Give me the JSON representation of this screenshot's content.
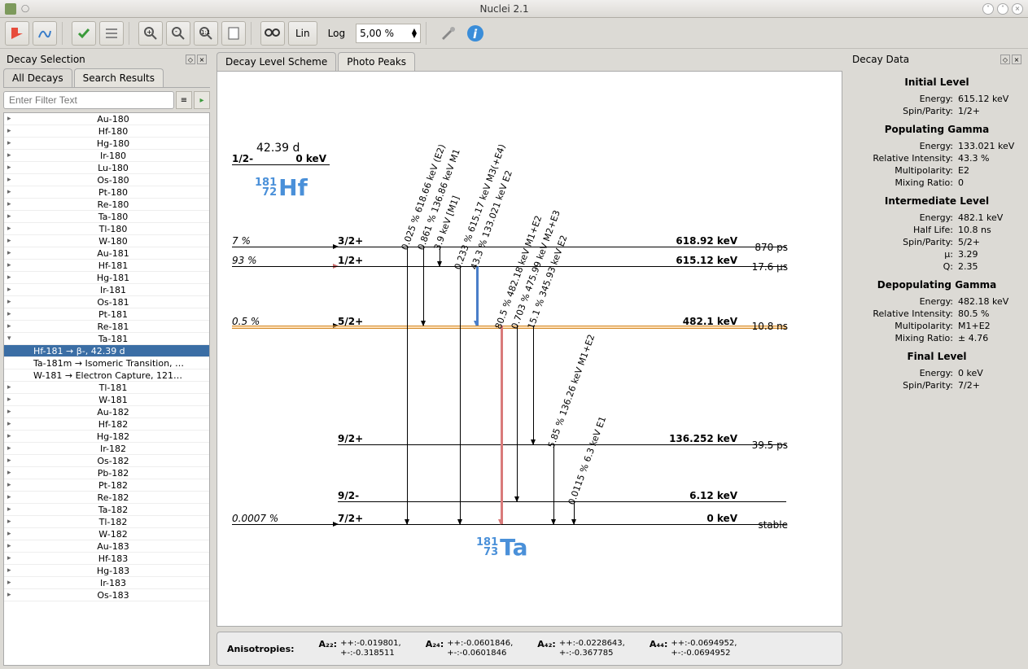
{
  "app": {
    "title": "Nuclei 2.1"
  },
  "toolbar": {
    "lin": "Lin",
    "log": "Log",
    "spinner": "5,00 %"
  },
  "left": {
    "title": "Decay Selection",
    "tab_all": "All Decays",
    "tab_search": "Search Results",
    "filter_placeholder": "Enter Filter Text",
    "items": [
      "Au-180",
      "Hf-180",
      "Hg-180",
      "Ir-180",
      "Lu-180",
      "Os-180",
      "Pt-180",
      "Re-180",
      "Ta-180",
      "Tl-180",
      "W-180",
      "Au-181",
      "Hf-181",
      "Hg-181",
      "Ir-181",
      "Os-181",
      "Pt-181",
      "Re-181",
      "Ta-181",
      "Tl-181",
      "W-181",
      "Au-182",
      "Hf-182",
      "Hg-182",
      "Ir-182",
      "Os-182",
      "Pb-182",
      "Pt-182",
      "Re-182",
      "Ta-182",
      "Tl-182",
      "W-182",
      "Au-183",
      "Hf-183",
      "Hg-183",
      "Ir-183",
      "Os-183"
    ],
    "ta181_children": [
      "Hf-181 → β-, 42.39 d",
      "Ta-181m → Isomeric Transition, …",
      "W-181 → Electron Capture, 121…"
    ]
  },
  "center": {
    "tab_scheme": "Decay Level Scheme",
    "tab_photo": "Photo Peaks",
    "parent_halflife": "42.39 d",
    "parent_spin": "1/2-",
    "parent_energy": "0 keV",
    "parent_nuclide": {
      "A": "181",
      "Z": "72",
      "sym": "Hf"
    },
    "daughter_nuclide": {
      "A": "181",
      "Z": "73",
      "sym": "Ta"
    },
    "levels": [
      {
        "spin": "3/2+",
        "energy": "618.92 keV",
        "hl": "870 ps",
        "pop": "7 %"
      },
      {
        "spin": "1/2+",
        "energy": "615.12 keV",
        "hl": "17.6 µs",
        "pop": "93 %"
      },
      {
        "spin": "5/2+",
        "energy": "482.1 keV",
        "hl": "10.8 ns",
        "pop": "0.5 %"
      },
      {
        "spin": "9/2+",
        "energy": "136.252 keV",
        "hl": "39.5 ps",
        "pop": ""
      },
      {
        "spin": "9/2-",
        "energy": "6.12 keV",
        "hl": "",
        "pop": ""
      },
      {
        "spin": "7/2+",
        "energy": "0 keV",
        "hl": "stable",
        "pop": "0.0007 %"
      }
    ],
    "gammas": [
      "0.025 % 618.66 keV (E2)",
      "0.861 % 136.86 keV M1",
      "3.9 keV [M1]",
      "0.233 % 615.17 keV M3(+E4)",
      "43.3 % 133.021 keV E2",
      "80.5 % 482.18 keV M1+E2",
      "0.703 % 475.99 keV M2+E3",
      "15.1 % 345.93 keV E2",
      "5.85 % 136.26 keV M1+E2",
      "0.0115 % 6.3 keV E1"
    ],
    "aniso": {
      "label": "Anisotropies:",
      "a22": {
        "k": "A₂₂:",
        "v": "++:-0.019801,\n+-:-0.318511"
      },
      "a24": {
        "k": "A₂₄:",
        "v": "++:-0.0601846,\n+-:-0.0601846"
      },
      "a42": {
        "k": "A₄₂:",
        "v": "++:-0.0228643,\n+-:-0.367785"
      },
      "a44": {
        "k": "A₄₄:",
        "v": "++:-0.0694952,\n+-:-0.0694952"
      }
    }
  },
  "right": {
    "title": "Decay Data",
    "sections": {
      "initial": {
        "h": "Initial Level",
        "rows": [
          [
            "Energy:",
            "615.12 keV"
          ],
          [
            "Spin/Parity:",
            "1/2+"
          ]
        ]
      },
      "popg": {
        "h": "Populating Gamma",
        "rows": [
          [
            "Energy:",
            "133.021 keV"
          ],
          [
            "Relative Intensity:",
            "43.3 %"
          ],
          [
            "Multipolarity:",
            "E2"
          ],
          [
            "Mixing Ratio:",
            "0"
          ]
        ]
      },
      "inter": {
        "h": "Intermediate Level",
        "rows": [
          [
            "Energy:",
            "482.1 keV"
          ],
          [
            "Half Life:",
            "10.8 ns"
          ],
          [
            "Spin/Parity:",
            "5/2+"
          ],
          [
            "µ:",
            "3.29"
          ],
          [
            "Q:",
            "2.35"
          ]
        ]
      },
      "depg": {
        "h": "Depopulating Gamma",
        "rows": [
          [
            "Energy:",
            "482.18 keV"
          ],
          [
            "Relative Intensity:",
            "80.5 %"
          ],
          [
            "Multipolarity:",
            "M1+E2"
          ],
          [
            "Mixing Ratio:",
            "± 4.76"
          ]
        ]
      },
      "final": {
        "h": "Final Level",
        "rows": [
          [
            "Energy:",
            "0 keV"
          ],
          [
            "Spin/Parity:",
            "7/2+"
          ]
        ]
      }
    }
  }
}
